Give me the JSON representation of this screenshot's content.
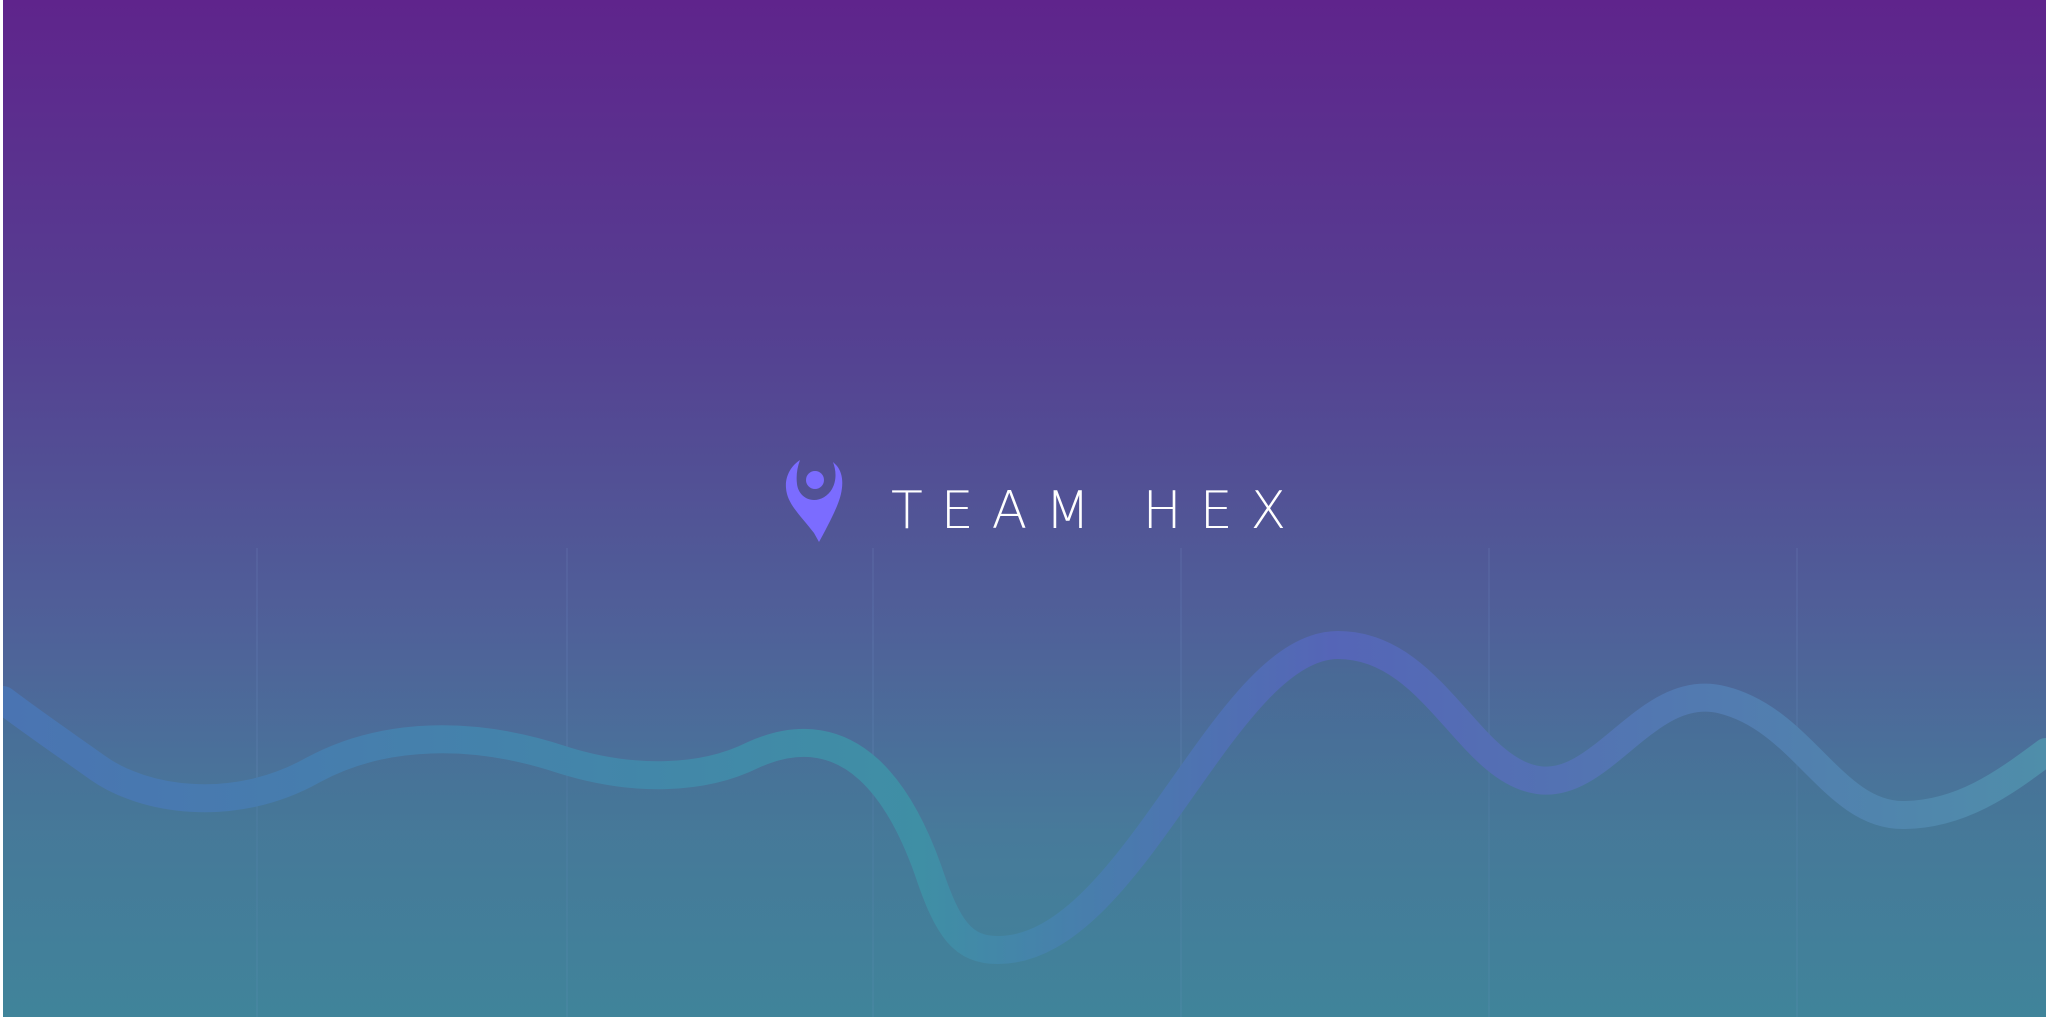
{
  "brand": {
    "name": "TEAM HEX",
    "logo_icon": "team-hex-logo-icon",
    "accent_color": "#7b6cff"
  },
  "background": {
    "gradient_top": "#5f248c",
    "gradient_bottom": "#40849a",
    "wave_icon": "wave-line-icon"
  }
}
